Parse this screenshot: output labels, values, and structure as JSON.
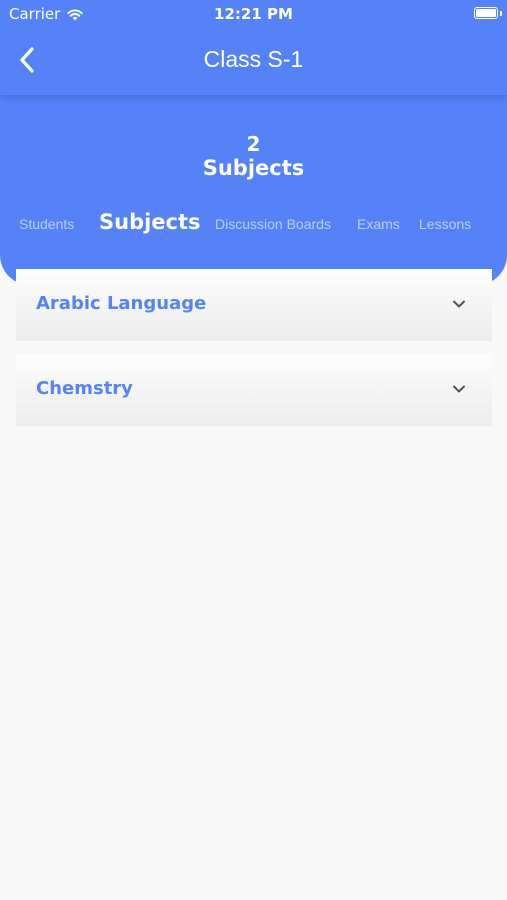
{
  "status_bar": {
    "carrier": "Carrier",
    "time": "12:21 PM"
  },
  "nav": {
    "title": "Class S-1",
    "back_icon": "chevron-left-icon"
  },
  "summary": {
    "count": "2",
    "label": "Subjects"
  },
  "tabs": [
    {
      "label": "Students",
      "active": false
    },
    {
      "label": "Subjects",
      "active": true
    },
    {
      "label": "Discussion Boards",
      "active": false
    },
    {
      "label": "Exams",
      "active": false
    },
    {
      "label": "Lessons",
      "active": false
    }
  ],
  "subjects": [
    {
      "name": "Arabic Language",
      "icon": "chevron-down-icon"
    },
    {
      "name": "Chemstry",
      "icon": "chevron-down-icon"
    }
  ],
  "colors": {
    "primary": "#5583f7",
    "background": "#f9f9f9",
    "card": "#f2f2f2"
  }
}
